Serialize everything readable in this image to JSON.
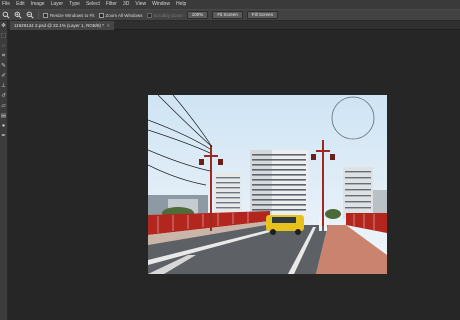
{
  "menu": [
    "File",
    "Edit",
    "Image",
    "Layer",
    "Type",
    "Select",
    "Filter",
    "3D",
    "View",
    "Window",
    "Help"
  ],
  "options": {
    "zoom_glyph": "🔍",
    "resize_windows": "Resize Windows to Fit",
    "zoom_all_windows": "Zoom All Windows",
    "scrubby_zoom": "Scrubby Zoom",
    "btn_100": "100%",
    "btn_fit": "Fit Screen",
    "btn_fill": "Fill Screen"
  },
  "document": {
    "tab_title": "11929134 3.psd @ 22.1% (Layer 1, RGB/8) *",
    "close": "×"
  },
  "colors": {
    "ui_dark": "#262626",
    "menu_bg": "#3a3a3a",
    "sky": "#e2eef7",
    "railing": "#b3261e"
  }
}
